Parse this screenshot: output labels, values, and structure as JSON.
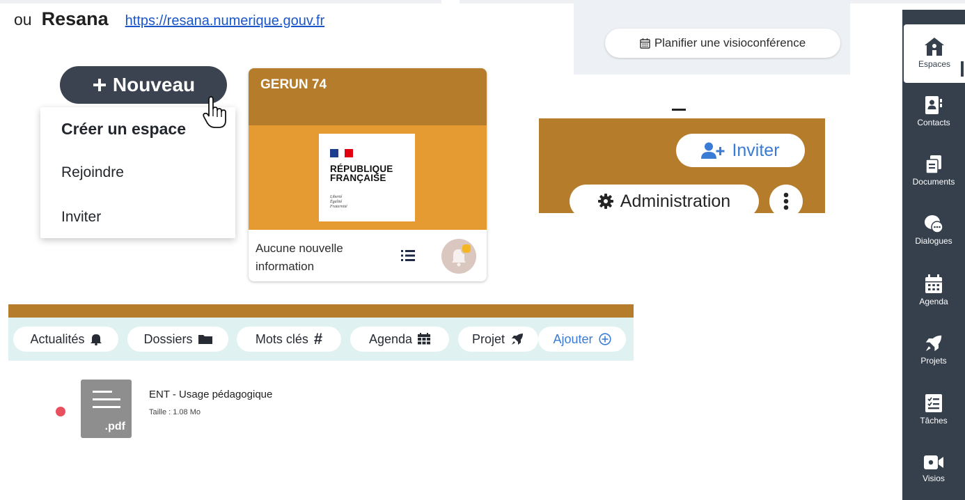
{
  "header": {
    "prefix": "ou",
    "brand": "Resana",
    "url": "https://resana.numerique.gouv.fr"
  },
  "visio": {
    "label": "Planifier une visioconférence"
  },
  "nouveau": {
    "label": "Nouveau",
    "menu": [
      "Créer un espace",
      "Rejoindre",
      "Inviter"
    ]
  },
  "card": {
    "title": "GERUN 74",
    "logo_line1": "RÉPUBLIQUE",
    "logo_line2": "FRANÇAISE",
    "motto": [
      "Liberté",
      "Égalité",
      "Fraternité"
    ],
    "info": "Aucune nouvelle information"
  },
  "space_actions": {
    "invite_label": "Inviter",
    "admin_label": "Administration"
  },
  "tabs": [
    {
      "label": "Actualités",
      "icon": "bell-icon"
    },
    {
      "label": "Dossiers",
      "icon": "folder-icon"
    },
    {
      "label": "Mots clés",
      "icon": "hash-icon"
    },
    {
      "label": "Agenda",
      "icon": "calendar-icon"
    },
    {
      "label": "Projet",
      "icon": "rocket-icon"
    },
    {
      "label": "Ajouter",
      "icon": "plus-circle-icon"
    }
  ],
  "document": {
    "name": "ENT - Usage pédagogique",
    "size": "Taille : 1.08 Mo",
    "extension": ".pdf"
  },
  "sidebar": {
    "items": [
      {
        "label": "Espaces",
        "icon": "home-icon",
        "active": true
      },
      {
        "label": "Contacts",
        "icon": "contacts-icon"
      },
      {
        "label": "Documents",
        "icon": "documents-icon"
      },
      {
        "label": "Dialogues",
        "icon": "dialogues-icon"
      },
      {
        "label": "Agenda",
        "icon": "calendar-icon"
      },
      {
        "label": "Projets",
        "icon": "rocket-icon"
      },
      {
        "label": "Tâches",
        "icon": "tasks-icon"
      },
      {
        "label": "Visios",
        "icon": "video-icon"
      }
    ]
  },
  "colors": {
    "brown": "#b47c2b",
    "orange": "#e59a32",
    "sidebar": "#36404d",
    "link": "#1a56c9",
    "accent": "#3a7bd5"
  }
}
